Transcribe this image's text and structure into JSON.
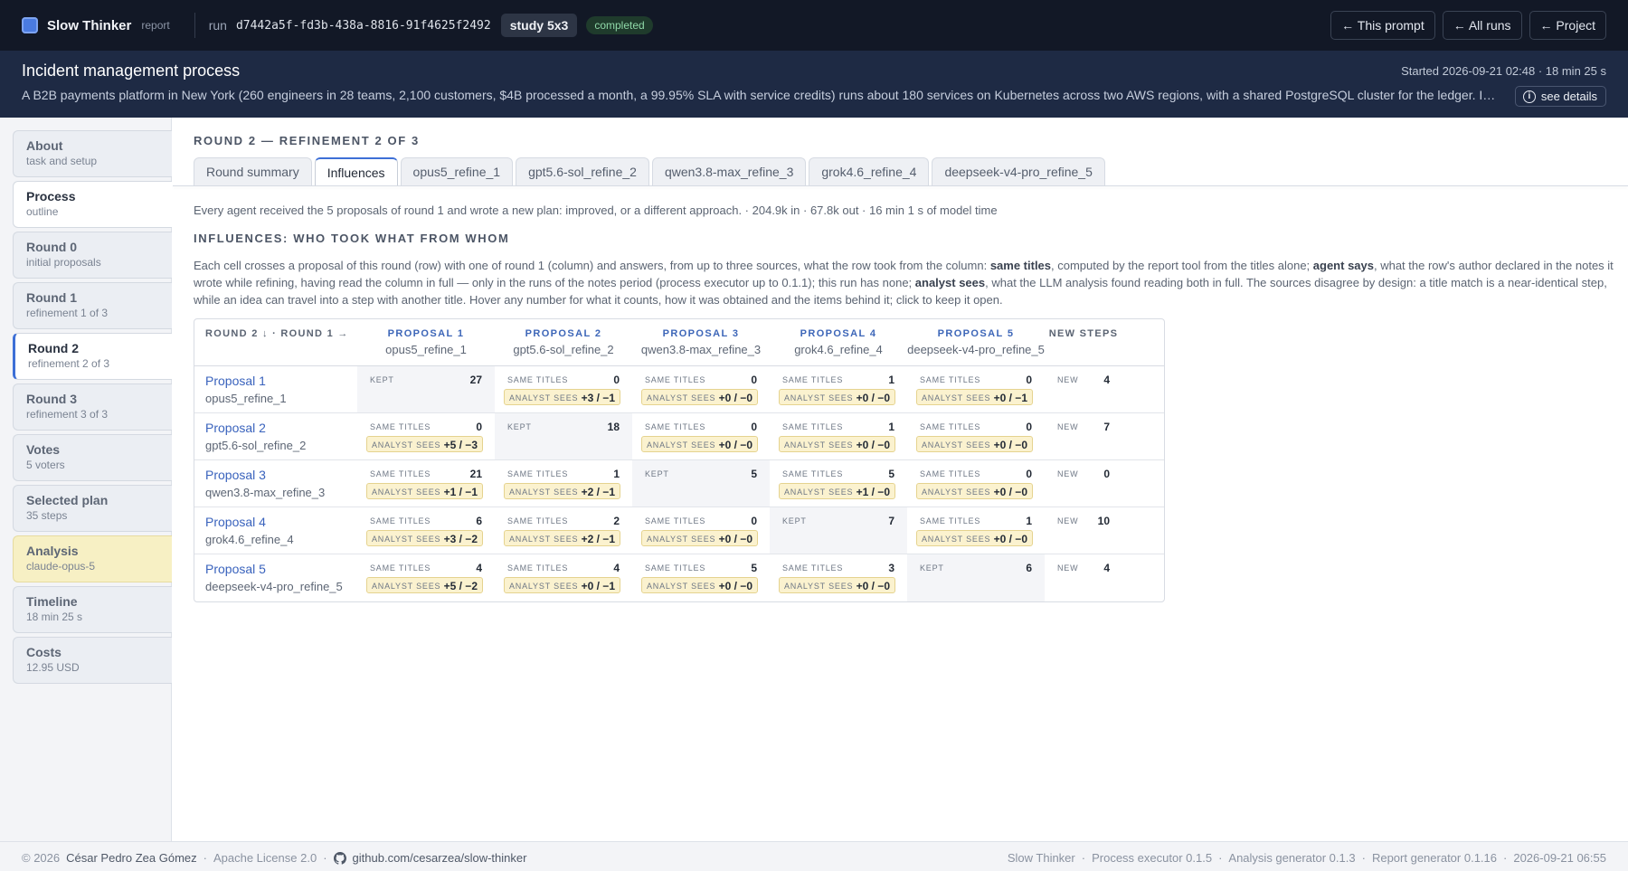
{
  "topbar": {
    "app_name": "Slow Thinker",
    "app_sub": "report",
    "run_label": "run",
    "run_id": "d7442a5f-fd3b-438a-8816-91f4625f2492",
    "study": "study 5x3",
    "status": "completed",
    "buttons": [
      "← This prompt",
      "← All runs",
      "← Project"
    ]
  },
  "header": {
    "title": "Incident management process",
    "description": "A B2B payments platform in New York (260 engineers in 28 teams, 2,100 customers, $4B processed a month, a 99.95% SLA with service credits) runs about 180 services on Kubernetes across two AWS regions, with a shared PostgreSQL cluster for the ledger. In the la...",
    "started": "Started 2026-09-21 02:48 · 18 min 25 s",
    "details_button": "see details"
  },
  "sidebar": {
    "items": [
      {
        "title": "About",
        "sub": "task and setup",
        "state": "normal"
      },
      {
        "title": "Process",
        "sub": "outline",
        "state": "white"
      },
      {
        "title": "Round 0",
        "sub": "initial proposals",
        "state": "normal"
      },
      {
        "title": "Round 1",
        "sub": "refinement 1 of 3",
        "state": "normal"
      },
      {
        "title": "Round 2",
        "sub": "refinement 2 of 3",
        "state": "active"
      },
      {
        "title": "Round 3",
        "sub": "refinement 3 of 3",
        "state": "normal"
      },
      {
        "title": "Votes",
        "sub": "5 voters",
        "state": "normal"
      },
      {
        "title": "Selected plan",
        "sub": "35 steps",
        "state": "normal"
      },
      {
        "title": "Analysis",
        "sub": "claude-opus-5",
        "state": "analysis"
      },
      {
        "title": "Timeline",
        "sub": "18 min 25 s",
        "state": "normal"
      },
      {
        "title": "Costs",
        "sub": "12.95 USD",
        "state": "normal"
      }
    ]
  },
  "main": {
    "round_heading": "ROUND 2 — REFINEMENT 2 OF 3",
    "tabs": [
      "Round summary",
      "Influences",
      "opus5_refine_1",
      "gpt5.6-sol_refine_2",
      "qwen3.8-max_refine_3",
      "grok4.6_refine_4",
      "deepseek-v4-pro_refine_5"
    ],
    "active_tab": 1,
    "summary": "Every agent received the 5 proposals of round 1 and wrote a new plan: improved, or a different approach. · 204.9k in · 67.8k out · 16 min 1 s of model time",
    "influences_heading": "INFLUENCES: WHO TOOK WHAT FROM WHOM",
    "desc": {
      "p1": "Each cell crosses a proposal of this round (row) with one of round 1 (column) and answers, from up to three sources, what the row took from the column: ",
      "b1": "same titles",
      "p2": ", computed by the report tool from the titles alone; ",
      "b2": "agent says",
      "p3": ", what the row's author declared in the notes it wrote while refining, having read the column in full — only in the runs of the notes period (process executor up to 0.1.1); this run has none; ",
      "b3": "analyst sees",
      "p4": ", what the LLM analysis found reading both in full. The sources disagree by design: a title match is a near-identical step, while an idea can travel into a step with another title. Hover any number for what it counts, how it was obtained and the items behind it; click to keep it open."
    }
  },
  "grid": {
    "corner": "ROUND 2 ↓ · ROUND 1 →",
    "new_steps_header": "NEW STEPS",
    "same_label": "SAME TITLES",
    "analyst_label": "ANALYST SEES",
    "kept_label": "KEPT",
    "new_label": "NEW",
    "columns": [
      {
        "label": "PROPOSAL 1",
        "model": "opus5_refine_1"
      },
      {
        "label": "PROPOSAL 2",
        "model": "gpt5.6-sol_refine_2"
      },
      {
        "label": "PROPOSAL 3",
        "model": "qwen3.8-max_refine_3"
      },
      {
        "label": "PROPOSAL 4",
        "model": "grok4.6_refine_4"
      },
      {
        "label": "PROPOSAL 5",
        "model": "deepseek-v4-pro_refine_5"
      }
    ],
    "rows": [
      {
        "label": "Proposal 1",
        "model": "opus5_refine_1",
        "new": "4",
        "cells": [
          {
            "kept": "27"
          },
          {
            "same": "0",
            "analyst": "+3 / −1"
          },
          {
            "same": "0",
            "analyst": "+0 / −0"
          },
          {
            "same": "1",
            "analyst": "+0 / −0"
          },
          {
            "same": "0",
            "analyst": "+0 / −1"
          }
        ]
      },
      {
        "label": "Proposal 2",
        "model": "gpt5.6-sol_refine_2",
        "new": "7",
        "cells": [
          {
            "same": "0",
            "analyst": "+5 / −3"
          },
          {
            "kept": "18"
          },
          {
            "same": "0",
            "analyst": "+0 / −0"
          },
          {
            "same": "1",
            "analyst": "+0 / −0"
          },
          {
            "same": "0",
            "analyst": "+0 / −0"
          }
        ]
      },
      {
        "label": "Proposal 3",
        "model": "qwen3.8-max_refine_3",
        "new": "0",
        "cells": [
          {
            "same": "21",
            "analyst": "+1 / −1"
          },
          {
            "same": "1",
            "analyst": "+2 / −1"
          },
          {
            "kept": "5"
          },
          {
            "same": "5",
            "analyst": "+1 / −0"
          },
          {
            "same": "0",
            "analyst": "+0 / −0"
          }
        ]
      },
      {
        "label": "Proposal 4",
        "model": "grok4.6_refine_4",
        "new": "10",
        "cells": [
          {
            "same": "6",
            "analyst": "+3 / −2"
          },
          {
            "same": "2",
            "analyst": "+2 / −1"
          },
          {
            "same": "0",
            "analyst": "+0 / −0"
          },
          {
            "kept": "7"
          },
          {
            "same": "1",
            "analyst": "+0 / −0"
          }
        ]
      },
      {
        "label": "Proposal 5",
        "model": "deepseek-v4-pro_refine_5",
        "new": "4",
        "cells": [
          {
            "same": "4",
            "analyst": "+5 / −2"
          },
          {
            "same": "4",
            "analyst": "+0 / −1"
          },
          {
            "same": "5",
            "analyst": "+0 / −0"
          },
          {
            "same": "3",
            "analyst": "+0 / −0"
          },
          {
            "kept": "6"
          }
        ]
      }
    ]
  },
  "footer": {
    "copyright": "© 2026",
    "author": "César Pedro Zea Gómez",
    "license": "Apache License 2.0",
    "repo": "github.com/cesarzea/slow-thinker",
    "right": [
      "Slow Thinker",
      "Process executor 0.1.5",
      "Analysis generator 0.1.3",
      "Report generator 0.1.16",
      "2026-09-21 06:55"
    ]
  }
}
